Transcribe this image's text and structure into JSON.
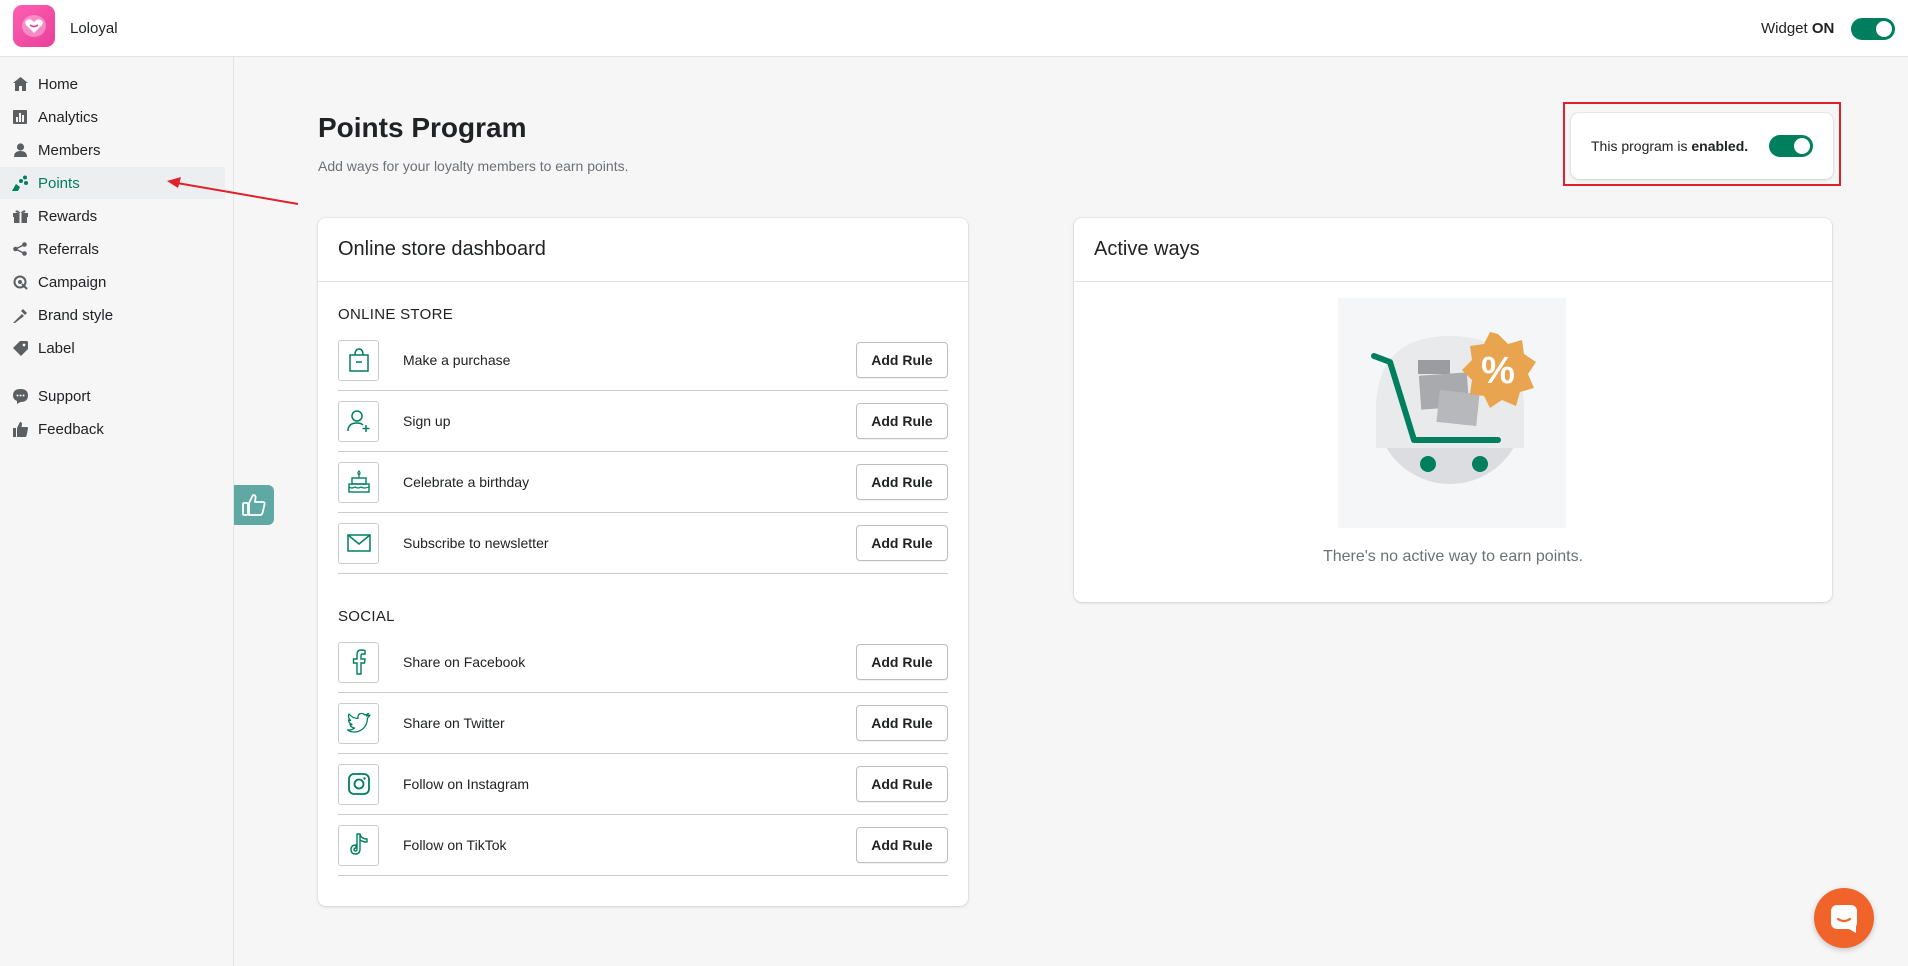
{
  "app": {
    "name": "Loloyal"
  },
  "topbar": {
    "widget_label": "Widget",
    "widget_state": "ON"
  },
  "sidebar": {
    "items": [
      {
        "label": "Home",
        "icon": "home-icon"
      },
      {
        "label": "Analytics",
        "icon": "analytics-icon"
      },
      {
        "label": "Members",
        "icon": "members-icon"
      },
      {
        "label": "Points",
        "icon": "points-icon",
        "active": true
      },
      {
        "label": "Rewards",
        "icon": "rewards-icon"
      },
      {
        "label": "Referrals",
        "icon": "referrals-icon"
      },
      {
        "label": "Campaign",
        "icon": "campaign-icon"
      },
      {
        "label": "Brand style",
        "icon": "brand-style-icon"
      },
      {
        "label": "Label",
        "icon": "label-icon"
      },
      {
        "label": "Support",
        "icon": "support-icon"
      },
      {
        "label": "Feedback",
        "icon": "feedback-icon"
      }
    ]
  },
  "page": {
    "title": "Points Program",
    "subtitle": "Add ways for your loyalty members to earn points."
  },
  "program_status": {
    "text_prefix": "This program is",
    "text_state": "enabled."
  },
  "dashboard": {
    "title": "Online store dashboard",
    "sections": [
      {
        "title": "ONLINE STORE",
        "rules": [
          {
            "label": "Make a purchase",
            "icon": "shopping-bag-icon",
            "button": "Add Rule"
          },
          {
            "label": "Sign up",
            "icon": "user-plus-icon",
            "button": "Add Rule"
          },
          {
            "label": "Celebrate a birthday",
            "icon": "cake-icon",
            "button": "Add Rule"
          },
          {
            "label": "Subscribe to newsletter",
            "icon": "envelope-icon",
            "button": "Add Rule"
          }
        ]
      },
      {
        "title": "SOCIAL",
        "rules": [
          {
            "label": "Share on Facebook",
            "icon": "facebook-icon",
            "button": "Add Rule"
          },
          {
            "label": "Share on Twitter",
            "icon": "twitter-icon",
            "button": "Add Rule"
          },
          {
            "label": "Follow on Instagram",
            "icon": "instagram-icon",
            "button": "Add Rule"
          },
          {
            "label": "Follow on TikTok",
            "icon": "tiktok-icon",
            "button": "Add Rule"
          }
        ]
      }
    ]
  },
  "active_ways": {
    "title": "Active ways",
    "empty_text": "There's no active way to earn points."
  },
  "colors": {
    "accent": "#007f5f",
    "brand": "#e83f99",
    "highlight": "#e0202b",
    "chat": "#f0642b"
  }
}
